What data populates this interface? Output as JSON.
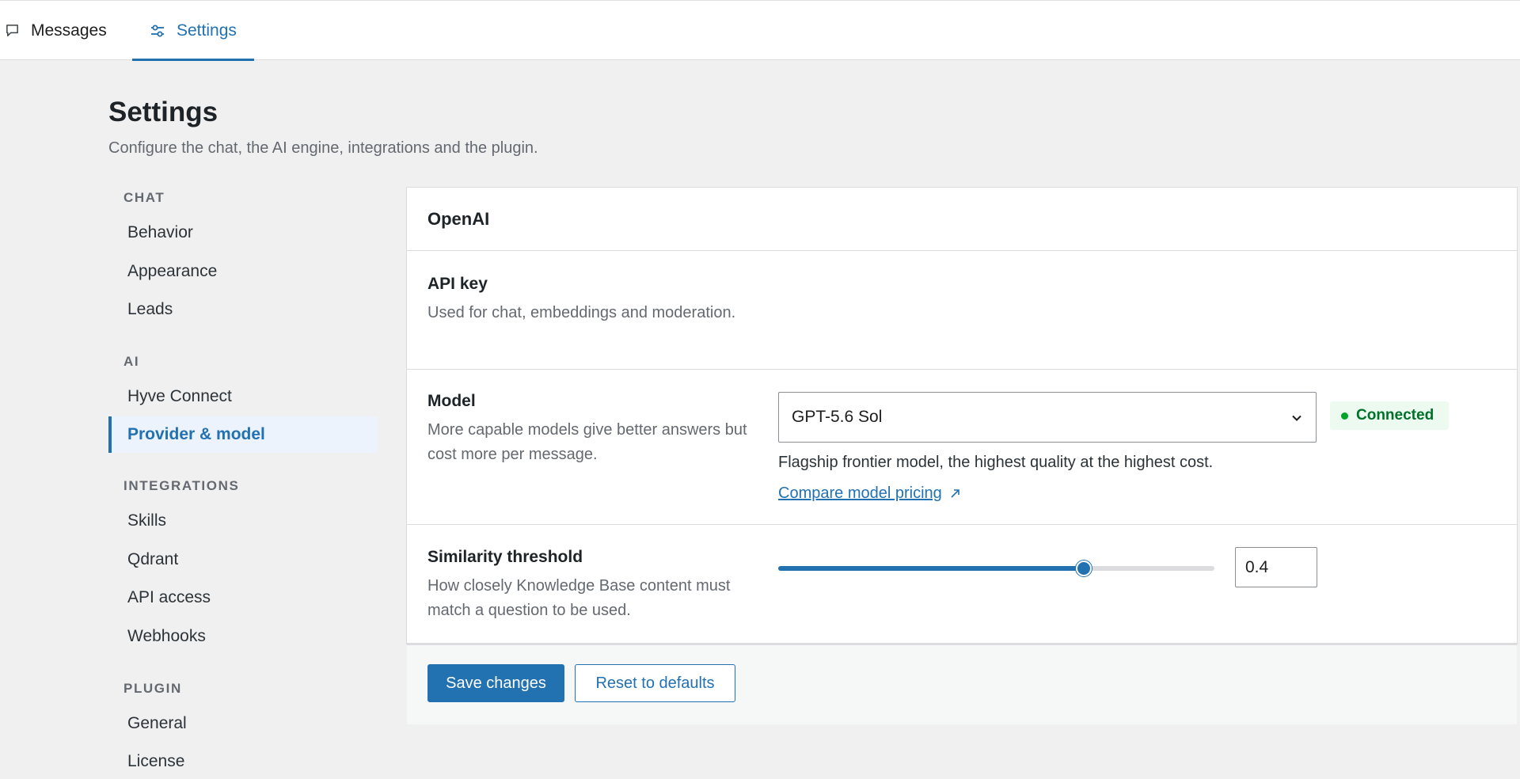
{
  "tabs": [
    {
      "label": "Messages",
      "icon": "message-icon"
    },
    {
      "label": "Settings",
      "icon": "sliders-icon",
      "active": true
    }
  ],
  "page": {
    "title": "Settings",
    "description": "Configure the chat, the AI engine, integrations and the plugin."
  },
  "nav": {
    "groups": [
      {
        "label": "CHAT",
        "items": [
          "Behavior",
          "Appearance",
          "Leads"
        ]
      },
      {
        "label": "AI",
        "items": [
          "Hyve Connect",
          "Provider & model"
        ]
      },
      {
        "label": "INTEGRATIONS",
        "items": [
          "Skills",
          "Qdrant",
          "API access",
          "Webhooks"
        ]
      },
      {
        "label": "PLUGIN",
        "items": [
          "General",
          "License"
        ]
      }
    ],
    "active_item": "Provider & model"
  },
  "card": {
    "title": "OpenAI",
    "api_key": {
      "label": "API key",
      "help": "Used for chat, embeddings and moderation.",
      "value": "••••••••••••••••••••••••••••••••••••••••••••••••••••••••••••••••",
      "status": "Connected"
    },
    "model": {
      "label": "Model",
      "help": "More capable models give better answers but cost more per message.",
      "selected": "GPT-5.6 Sol",
      "description": "Flagship frontier model, the highest quality at the highest cost.",
      "pricing_link": "Compare model pricing"
    },
    "similarity": {
      "label": "Similarity threshold",
      "help": "How closely Knowledge Base content must match a question to be used.",
      "value": "0.4",
      "slider_fraction": 0.7
    }
  },
  "actions": {
    "save": "Save changes",
    "reset": "Reset to defaults"
  },
  "colors": {
    "accent": "#2271b1",
    "success": "#00712a",
    "success_bg": "#edfaef"
  }
}
